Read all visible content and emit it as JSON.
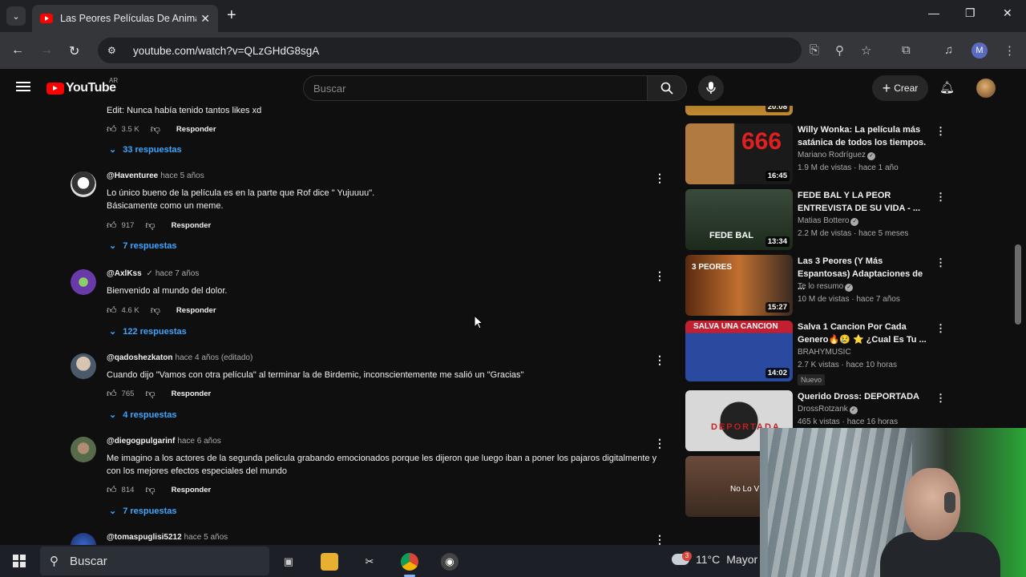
{
  "browser": {
    "tab_title": "Las Peores Películas De Animale",
    "url": "youtube.com/watch?v=QLzGHdG8sgA",
    "profile_initial": "M"
  },
  "youtube": {
    "logo_text": "YouTube",
    "country_code": "AR",
    "search_placeholder": "Buscar",
    "create_label": "Crear"
  },
  "comments": {
    "prev_text": "Edit: Nunca había tenido tantos likes xd",
    "prev_likes": "3.5 K",
    "prev_reply": "Responder",
    "prev_replies": "33 respuestas",
    "items": [
      {
        "user": "@Haventuree",
        "date": "hace 5 años",
        "text": "Lo único bueno de la película es en la parte que Rof dice \" Yujuuuu\".\nBásicamente como un meme.",
        "likes": "917",
        "reply": "Responder",
        "replies": "7 respuestas"
      },
      {
        "user": "@AxlKss",
        "date": "hace 7 años",
        "text": "Bienvenido al mundo del dolor.",
        "likes": "4.6 K",
        "reply": "Responder",
        "replies": "122 respuestas"
      },
      {
        "user": "@qadoshezkaton",
        "date": "hace 4 años (editado)",
        "text": "Cuando dijo \"Vamos con otra película\" al terminar la de Birdemic, inconscientemente me salió un \"Gracias\"",
        "likes": "765",
        "reply": "Responder",
        "replies": "4 respuestas"
      },
      {
        "user": "@diegogpulgarinf",
        "date": "hace 6 años",
        "text": "Me imagino a los actores de la segunda pelicula grabando emocionados porque les dijeron que luego iban a poner los pajaros digitalmente y con los mejores efectos especiales del mundo",
        "likes": "814",
        "reply": "Responder",
        "replies": "7 respuestas"
      },
      {
        "user": "@tomaspuglisi5212",
        "date": "hace 5 años"
      }
    ]
  },
  "related": [
    {
      "duration": "20:08"
    },
    {
      "title": "Willy Wonka: La película más satánica de todos los tiempos.",
      "channel": "Mariano Rodríguez",
      "meta": "1.9 M de vistas · hace 1 año",
      "duration": "16:45",
      "thumb_text": "666"
    },
    {
      "title": "FEDE BAL Y LA PEOR ENTREVISTA DE SU VIDA - ...",
      "channel": "Matias Bottero",
      "meta": "2.2 M de vistas · hace 5 meses",
      "duration": "13:34",
      "thumb_text": "FEDE BAL"
    },
    {
      "title": "Las 3 Peores (Y Más Espantosas) Adaptaciones de ...",
      "channel": "Te lo resumo",
      "meta": "10 M de vistas · hace 7 años",
      "duration": "15:27",
      "thumb_text": "3 PEORES"
    },
    {
      "title": "Salva 1 Cancion Por Cada Genero🔥😢 ⭐ ¿Cual Es Tu ...",
      "channel": "BRAHYMUSIC",
      "meta": "2.7 K vistas · hace 10 horas",
      "duration": "14:02",
      "badge": "Nuevo",
      "thumb_text": "SALVA UNA CANCION"
    },
    {
      "title": "Querido Dross: DEPORTADA",
      "channel": "DrossRotzank",
      "meta": "465 k vistas · hace 16 horas",
      "thumb_text": "DEPORTADA"
    },
    {
      "thumb_text": "No Lo V"
    }
  ],
  "taskbar": {
    "search_label": "Buscar",
    "weather_temp": "11°C",
    "weather_text": "Mayor",
    "weather_badge": "3"
  },
  "colors": {
    "accent_blue": "#3ea6ff",
    "youtube_red": "#ff0000"
  }
}
